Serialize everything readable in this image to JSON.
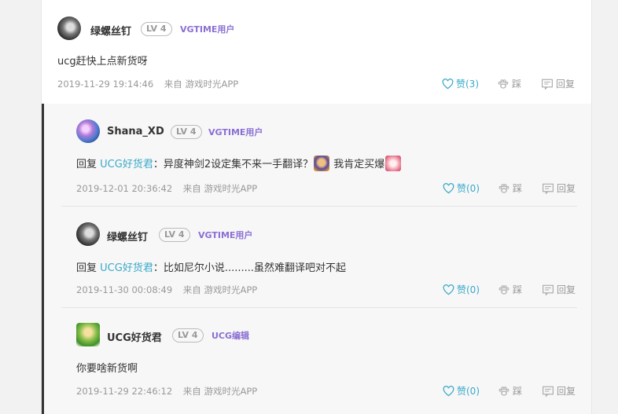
{
  "main": {
    "username": "绿螺丝钉",
    "level": "LV 4",
    "role": "VGTIME用户",
    "content": "ucg赶快上点新货呀",
    "date": "2019-11-29 19:14:46",
    "source": "来自 游戏时光APP",
    "like_label": "赞(3)",
    "step_label": "踩",
    "reply_label": "回复"
  },
  "replies": [
    {
      "username": "Shana_XD",
      "level": "LV 4",
      "role": "VGTIME用户",
      "reply_prefix": "回复",
      "reply_to": "UCG好货君",
      "content": "：异度神剑2设定集不来一手翻译？",
      "content_after": "我肯定买爆",
      "date": "2019-12-01 20:36:42",
      "source": "来自 游戏时光APP",
      "like_label": "赞(0)",
      "step_label": "踩",
      "reply_label": "回复"
    },
    {
      "username": "绿螺丝钉",
      "level": "LV 4",
      "role": "VGTIME用户",
      "reply_prefix": "回复",
      "reply_to": "UCG好货君",
      "content": "：比如尼尔小说.........虽然难翻译吧对不起",
      "date": "2019-11-30 00:08:49",
      "source": "来自 游戏时光APP",
      "like_label": "赞(0)",
      "step_label": "踩",
      "reply_label": "回复"
    },
    {
      "username": "UCG好货君",
      "level": "LV 4",
      "role": "UCG编辑",
      "content": "你要啥新货啊",
      "date": "2019-11-29 22:46:12",
      "source": "来自 游戏时光APP",
      "like_label": "赞(0)",
      "step_label": "踩",
      "reply_label": "回复"
    }
  ],
  "colors": {
    "accent": "#3aa9c9",
    "role": "#8a6fd4",
    "meta": "#999999"
  }
}
